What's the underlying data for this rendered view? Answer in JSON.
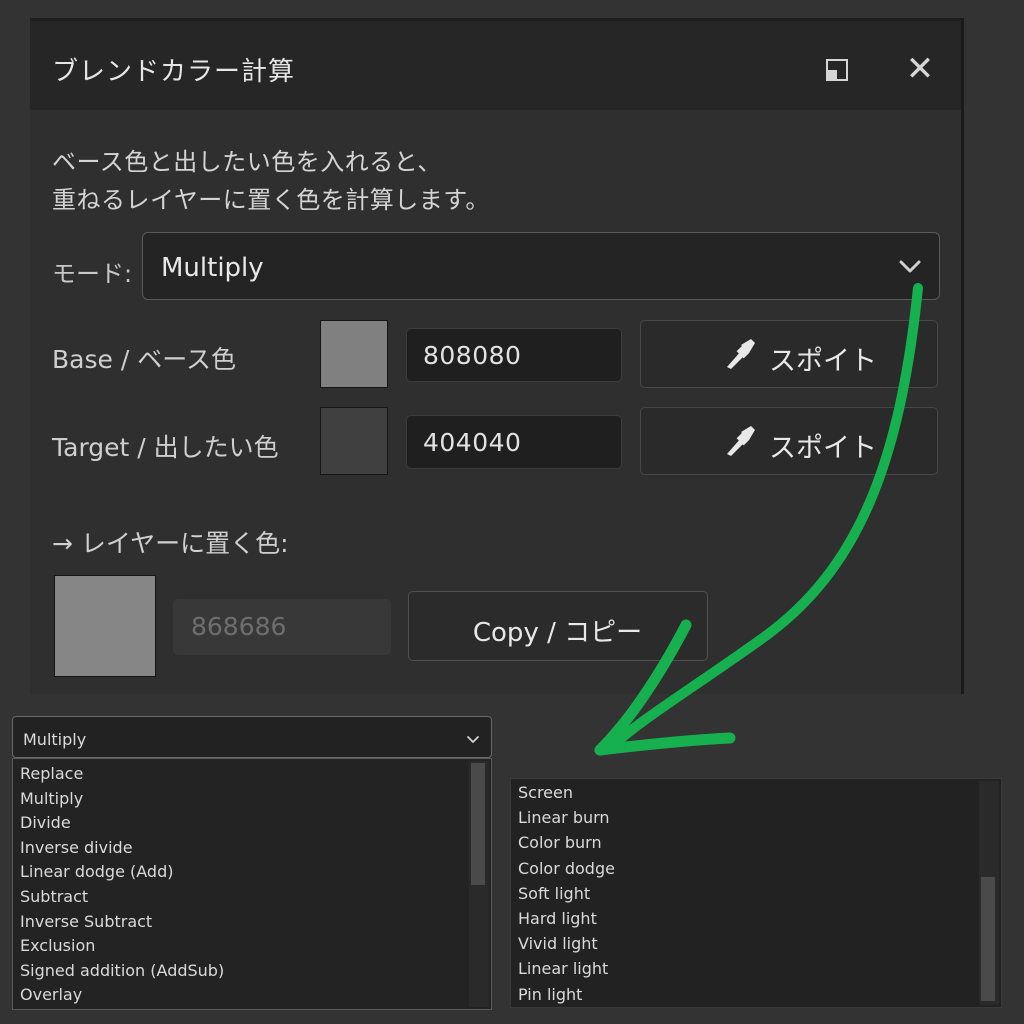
{
  "dialog": {
    "title": "ブレンドカラー計算",
    "description_line1": "ベース色と出したい色を入れると、",
    "description_line2": "重ねるレイヤーに置く色を計算します。",
    "mode_label": "モード:",
    "mode_value": "Multiply",
    "base": {
      "label": "Base / ベース色",
      "hex": "808080",
      "swatch_color": "#808080",
      "picker_label": "スポイト"
    },
    "target": {
      "label": "Target / 出したい色",
      "hex": "404040",
      "swatch_color": "#404040",
      "picker_label": "スポイト"
    },
    "result": {
      "label": "→ レイヤーに置く色:",
      "hex": "868686",
      "swatch_color": "#868686",
      "copy_label": "Copy / コピー"
    }
  },
  "dropdown": {
    "selected": "Multiply",
    "list_left": [
      "Replace",
      "Multiply",
      "Divide",
      "Inverse divide",
      "Linear dodge (Add)",
      "Subtract",
      "Inverse Subtract",
      "Exclusion",
      "Signed addition (AddSub)",
      "Overlay"
    ],
    "list_right": [
      "Screen",
      "Linear burn",
      "Color burn",
      "Color dodge",
      "Soft light",
      "Hard light",
      "Vivid light",
      "Linear light",
      "Pin light"
    ]
  },
  "colors": {
    "arrow": "#16b04f",
    "background": "#333333",
    "panel": "#2f2f2f"
  },
  "icons": {
    "restore": "restore-window-icon",
    "close": "close-icon",
    "chevron": "chevron-down-icon",
    "eyedropper": "eyedropper-icon"
  }
}
